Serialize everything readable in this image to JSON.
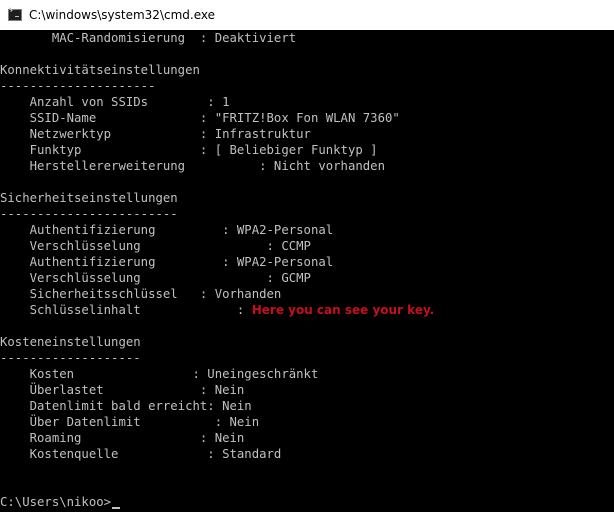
{
  "window": {
    "title": "C:\\windows\\system32\\cmd.exe"
  },
  "console": {
    "lines": [
      "       MAC-Randomisierung  : Deaktiviert",
      "",
      "Konnektivitätseinstellungen",
      "---------------------",
      "    Anzahl von SSIDs        : 1",
      "    SSID-Name              : \"FRITZ!Box Fon WLAN 7360\"",
      "    Netzwerktyp            : Infrastruktur",
      "    Funktyp                : [ Beliebiger Funktyp ]",
      "    Herstellererweiterung          : Nicht vorhanden",
      "",
      "Sicherheitseinstellungen",
      "------------------------",
      "    Authentifizierung         : WPA2-Personal",
      "    Verschlüsselung                 : CCMP",
      "    Authentifizierung         : WPA2-Personal",
      "    Verschlüsselung                 : GCMP",
      "    Sicherheitsschlüssel   : Vorhanden",
      "    Schlüsselinhalt             : ",
      "",
      "Kosteneinstellungen",
      "-------------------",
      "    Kosten                : Uneingeschränkt",
      "    Überlastet             : Nein",
      "    Datenlimit bald erreicht: Nein",
      "    Über Datenlimit          : Nein",
      "    Roaming                : Nein",
      "    Kostenquelle            : Standard",
      "",
      "",
      "C:\\Users\\nikoo>"
    ],
    "key_highlight": "Here you can see your key."
  },
  "colors": {
    "console_bg": "#000000",
    "console_text": "#c0c0c0",
    "highlight_text": "#c50f1f",
    "titlebar_bg": "#ffffff"
  }
}
